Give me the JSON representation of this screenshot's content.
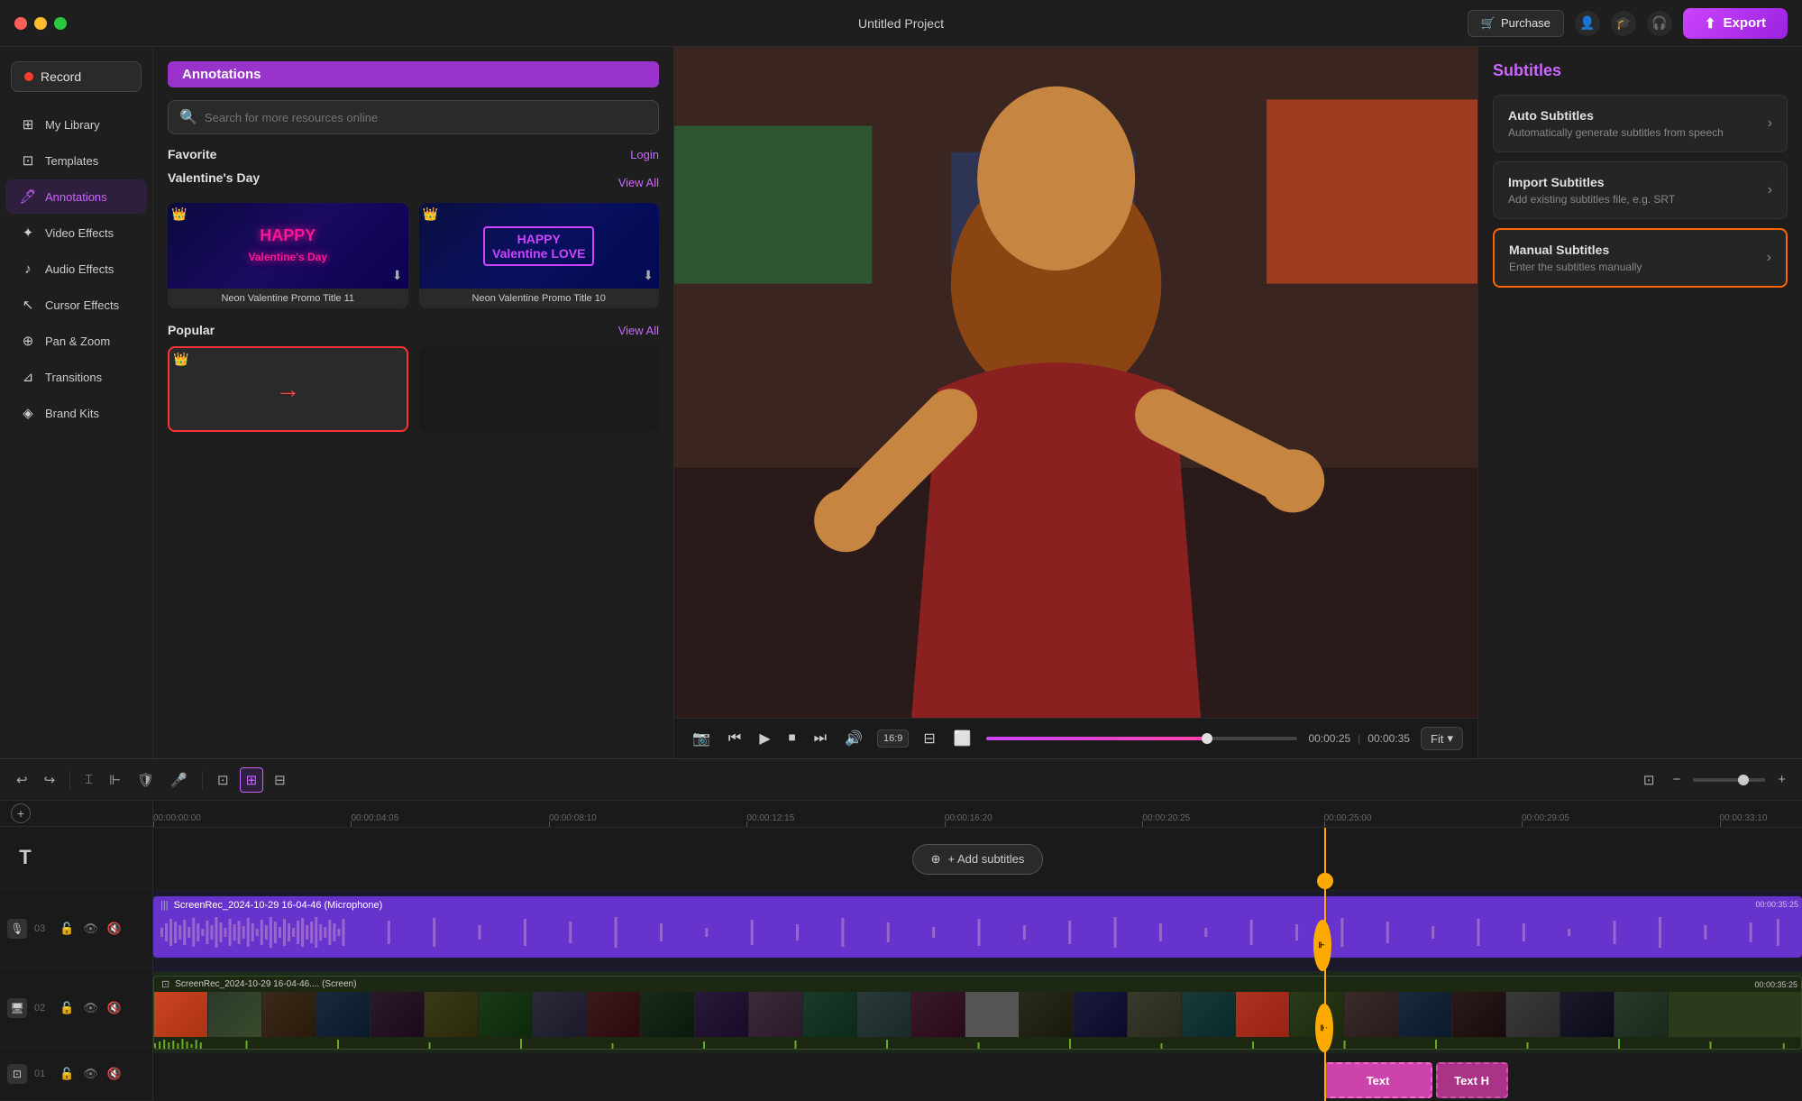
{
  "titlebar": {
    "title": "Untitled Project",
    "purchase_label": "Purchase",
    "export_label": "Export"
  },
  "sidebar": {
    "record_label": "Record",
    "items": [
      {
        "id": "my-library",
        "label": "My Library",
        "icon": "⊞"
      },
      {
        "id": "templates",
        "label": "Templates",
        "icon": "⊡"
      },
      {
        "id": "annotations",
        "label": "Annotations",
        "icon": "🖊"
      },
      {
        "id": "video-effects",
        "label": "Video Effects",
        "icon": "✦"
      },
      {
        "id": "audio-effects",
        "label": "Audio Effects",
        "icon": "♪"
      },
      {
        "id": "cursor-effects",
        "label": "Cursor Effects",
        "icon": "↖"
      },
      {
        "id": "pan-zoom",
        "label": "Pan & Zoom",
        "icon": "⊕"
      },
      {
        "id": "transitions",
        "label": "Transitions",
        "icon": "⊿"
      },
      {
        "id": "brand-kits",
        "label": "Brand Kits",
        "icon": "◈"
      }
    ]
  },
  "left_panel": {
    "title": "Annotations",
    "search_placeholder": "Search for more resources online",
    "favorite_label": "Favorite",
    "login_label": "Login",
    "valentines_section": {
      "title": "Valentine's Day",
      "view_all_label": "View All",
      "cards": [
        {
          "title": "Neon Valentine Promo Title 11",
          "text1": "HAPPY",
          "text2": "Valentine's Day"
        },
        {
          "title": "Neon Valentine Promo Title 10",
          "text1": "HAPPY",
          "text2": "Valentine LOVE"
        }
      ]
    },
    "popular_section": {
      "title": "Popular",
      "view_all_label": "View All"
    }
  },
  "preview": {
    "current_time": "00:00:25",
    "separator": "|",
    "total_time": "00:00:35",
    "progress_percent": 71,
    "fit_label": "Fit"
  },
  "right_panel": {
    "title": "Subtitles",
    "options": [
      {
        "id": "auto-subtitles",
        "title": "Auto Subtitles",
        "desc": "Automatically generate subtitles from speech",
        "selected": false
      },
      {
        "id": "import-subtitles",
        "title": "Import Subtitles",
        "desc": "Add existing subtitles file, e.g. SRT",
        "selected": false
      },
      {
        "id": "manual-subtitles",
        "title": "Manual Subtitles",
        "desc": "Enter the subtitles manually",
        "selected": true
      }
    ]
  },
  "timeline": {
    "toolbar": {
      "zoom_minus": "−",
      "zoom_plus": "+"
    },
    "add_subtitles_label": "+ Add subtitles",
    "ruler_marks": [
      {
        "label": "00:00:00:00",
        "pos_percent": 0
      },
      {
        "label": "00:00:04:05",
        "pos_percent": 12
      },
      {
        "label": "00:00:08:10",
        "pos_percent": 24
      },
      {
        "label": "00:00:12:15",
        "pos_percent": 36
      },
      {
        "label": "00:00:16:20",
        "pos_percent": 48
      },
      {
        "label": "00:00:20:25",
        "pos_percent": 60
      },
      {
        "label": "00:00:25:00",
        "pos_percent": 71
      },
      {
        "label": "00:00:29:05",
        "pos_percent": 83
      },
      {
        "label": "00:00:33:10",
        "pos_percent": 95
      }
    ],
    "tracks": [
      {
        "num": "",
        "type": "text",
        "clips": []
      },
      {
        "num": "03",
        "type": "audio",
        "label": "ScreenRec_2024-10-29 16-04-46 (Microphone)",
        "time": "00:00:35:25"
      },
      {
        "num": "02",
        "type": "video",
        "label": "ScreenRec_2024-10-29 16-04-46.... (Screen)",
        "time": "00:00:35:25"
      },
      {
        "num": "01",
        "type": "text-clip",
        "clips": [
          {
            "label": "Text",
            "label2": "Text H",
            "start_percent": 72,
            "width_percent": 20
          }
        ]
      }
    ],
    "playhead_percent": 71
  }
}
